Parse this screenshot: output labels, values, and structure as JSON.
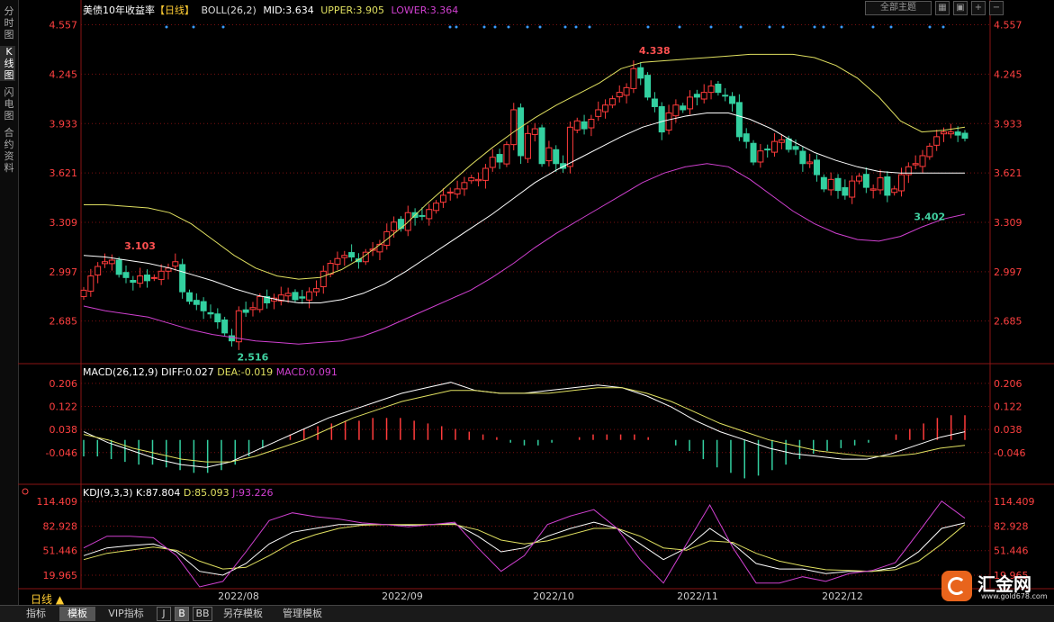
{
  "sidebar": {
    "tabs": [
      {
        "label": "分时图",
        "active": false
      },
      {
        "label": "K线图",
        "active": true
      },
      {
        "label": "闪电图",
        "active": false
      },
      {
        "label": "合约资料",
        "active": false
      }
    ]
  },
  "header": {
    "title": "美债10年收益率",
    "period_tag": "【日线】",
    "indicator": "BOLL(26,2)",
    "mid": "MID:3.634",
    "upper": "UPPER:3.905",
    "lower": "LOWER:3.364"
  },
  "toolbar": {
    "theme_select": "全部主题",
    "buttons": [
      "grid-icon",
      "lock-icon",
      "zoom-in-icon",
      "zoom-out-icon"
    ]
  },
  "macd_header": {
    "name": "MACD(26,12,9)",
    "diff": "DIFF:0.027",
    "dea": "DEA:-0.019",
    "macd": "MACD:0.091"
  },
  "kdj_header": {
    "name": "KDJ(9,3,3)",
    "k": "K:87.804",
    "d": "D:85.093",
    "j": "J:93.226"
  },
  "bottom_tabs": {
    "period": "日线 ▲",
    "tabs": [
      {
        "label": "指标",
        "active": false
      },
      {
        "label": "模板",
        "active": true
      },
      {
        "label": "VIP指标",
        "active": false
      },
      {
        "label": "J",
        "active": false
      },
      {
        "label": "B",
        "active": true
      },
      {
        "label": "BB",
        "active": false
      },
      {
        "label": "另存模板",
        "active": false
      },
      {
        "label": "管理模板",
        "active": false
      }
    ]
  },
  "logo": {
    "name": "汇金网",
    "url": "www.gold678.com"
  },
  "colors": {
    "up": "#ff3b3b",
    "down": "#33d0a0",
    "mid": "#ffffff",
    "upper": "#e0e060",
    "lower": "#d040d0",
    "grid": "#7a1010",
    "axis_text": "#ff4040",
    "macd_up": "#ff3b3b",
    "macd_down": "#33d0a0"
  },
  "chart_data": [
    {
      "type": "candlestick",
      "title": "美债10年收益率",
      "y_ticks": [
        4.557,
        4.245,
        3.933,
        3.621,
        3.309,
        2.997,
        2.685
      ],
      "ylim": [
        2.45,
        4.6
      ],
      "x_ticks": [
        "2022/08",
        "2022/09",
        "2022/10",
        "2022/11",
        "2022/12"
      ],
      "annotations": [
        {
          "label": "3.103",
          "value": 3.103,
          "kind": "high"
        },
        {
          "label": "2.516",
          "value": 2.516,
          "kind": "low"
        },
        {
          "label": "4.338",
          "value": 4.338,
          "kind": "high"
        },
        {
          "label": "3.402",
          "value": 3.402,
          "kind": "low"
        }
      ],
      "closes": [
        2.88,
        2.97,
        3.03,
        3.06,
        3.07,
        2.98,
        2.96,
        2.93,
        2.97,
        2.94,
        2.96,
        3.0,
        3.02,
        3.06,
        2.87,
        2.81,
        2.79,
        2.75,
        2.73,
        2.68,
        2.61,
        2.56,
        2.75,
        2.74,
        2.77,
        2.84,
        2.8,
        2.83,
        2.85,
        2.86,
        2.82,
        2.83,
        2.87,
        2.89,
        3.0,
        3.05,
        3.08,
        3.1,
        3.09,
        3.06,
        3.12,
        3.14,
        3.17,
        3.25,
        3.31,
        3.27,
        3.37,
        3.34,
        3.35,
        3.39,
        3.43,
        3.48,
        3.5,
        3.52,
        3.56,
        3.59,
        3.58,
        3.65,
        3.72,
        3.69,
        3.8,
        4.02,
        3.73,
        3.87,
        3.9,
        3.68,
        3.78,
        3.68,
        3.65,
        3.91,
        3.95,
        3.9,
        3.96,
        4.02,
        4.05,
        4.09,
        4.13,
        4.16,
        4.28,
        4.22,
        4.1,
        4.04,
        3.88,
        4.0,
        4.05,
        4.02,
        4.1,
        4.1,
        4.13,
        4.17,
        4.13,
        4.11,
        4.06,
        3.85,
        3.82,
        3.69,
        3.76,
        3.77,
        3.82,
        3.83,
        3.77,
        3.77,
        3.68,
        3.69,
        3.61,
        3.52,
        3.58,
        3.51,
        3.48,
        3.57,
        3.6,
        3.53,
        3.52,
        3.59,
        3.48,
        3.52,
        3.61,
        3.66,
        3.68,
        3.73,
        3.79,
        3.85,
        3.88,
        3.88,
        3.86,
        3.84
      ],
      "series": [
        {
          "name": "MID",
          "values": [
            3.1,
            3.09,
            3.07,
            3.05,
            3.02,
            2.98,
            2.94,
            2.89,
            2.85,
            2.82,
            2.8,
            2.8,
            2.82,
            2.86,
            2.92,
            3.0,
            3.09,
            3.18,
            3.27,
            3.36,
            3.46,
            3.56,
            3.64,
            3.71,
            3.78,
            3.85,
            3.91,
            3.95,
            3.98,
            4.0,
            4.0,
            3.96,
            3.9,
            3.82,
            3.75,
            3.7,
            3.66,
            3.63,
            3.62,
            3.62,
            3.62,
            3.62
          ]
        },
        {
          "name": "UPPER",
          "values": [
            3.42,
            3.42,
            3.41,
            3.4,
            3.37,
            3.3,
            3.2,
            3.1,
            3.02,
            2.97,
            2.95,
            2.96,
            3.01,
            3.09,
            3.19,
            3.3,
            3.43,
            3.55,
            3.67,
            3.78,
            3.88,
            3.97,
            4.05,
            4.12,
            4.19,
            4.28,
            4.32,
            4.33,
            4.34,
            4.35,
            4.36,
            4.37,
            4.37,
            4.37,
            4.35,
            4.3,
            4.22,
            4.1,
            3.95,
            3.88,
            3.89,
            3.91
          ]
        },
        {
          "name": "LOWER",
          "values": [
            2.78,
            2.75,
            2.73,
            2.71,
            2.67,
            2.63,
            2.6,
            2.58,
            2.56,
            2.55,
            2.54,
            2.55,
            2.56,
            2.59,
            2.64,
            2.7,
            2.76,
            2.82,
            2.88,
            2.96,
            3.05,
            3.15,
            3.24,
            3.32,
            3.4,
            3.48,
            3.56,
            3.62,
            3.66,
            3.68,
            3.66,
            3.58,
            3.48,
            3.38,
            3.3,
            3.24,
            3.2,
            3.19,
            3.22,
            3.28,
            3.33,
            3.36
          ]
        }
      ]
    },
    {
      "type": "bar",
      "title": "MACD(26,12,9)",
      "y_ticks": [
        0.206,
        0.122,
        0.038,
        -0.046
      ],
      "ylim": [
        -0.155,
        0.245
      ],
      "histogram": [
        -0.06,
        -0.06,
        -0.07,
        -0.08,
        -0.09,
        -0.09,
        -0.1,
        -0.11,
        -0.12,
        -0.12,
        -0.11,
        -0.09,
        -0.06,
        -0.03,
        0.0,
        0.02,
        0.04,
        0.05,
        0.06,
        0.07,
        0.07,
        0.08,
        0.08,
        0.08,
        0.07,
        0.06,
        0.05,
        0.04,
        0.03,
        0.02,
        0.01,
        -0.01,
        -0.02,
        -0.02,
        -0.01,
        0.0,
        0.01,
        0.02,
        0.02,
        0.02,
        0.02,
        0.01,
        0.0,
        -0.02,
        -0.04,
        -0.07,
        -0.1,
        -0.12,
        -0.14,
        -0.13,
        -0.11,
        -0.09,
        -0.07,
        -0.05,
        -0.04,
        -0.03,
        -0.02,
        -0.01,
        0.0,
        0.02,
        0.04,
        0.06,
        0.08,
        0.09,
        0.09
      ],
      "series": [
        {
          "name": "DIFF",
          "values": [
            0.03,
            -0.01,
            -0.04,
            -0.07,
            -0.09,
            -0.1,
            -0.08,
            -0.04,
            0.0,
            0.04,
            0.08,
            0.11,
            0.14,
            0.17,
            0.19,
            0.21,
            0.18,
            0.17,
            0.17,
            0.18,
            0.19,
            0.2,
            0.19,
            0.16,
            0.12,
            0.07,
            0.03,
            0.0,
            -0.03,
            -0.05,
            -0.06,
            -0.07,
            -0.07,
            -0.05,
            -0.02,
            0.01,
            0.03
          ]
        },
        {
          "name": "DEA",
          "values": [
            0.02,
            0.0,
            -0.03,
            -0.05,
            -0.07,
            -0.08,
            -0.08,
            -0.06,
            -0.03,
            0.0,
            0.04,
            0.08,
            0.11,
            0.14,
            0.16,
            0.18,
            0.18,
            0.17,
            0.17,
            0.17,
            0.18,
            0.19,
            0.19,
            0.17,
            0.14,
            0.1,
            0.06,
            0.03,
            0.0,
            -0.02,
            -0.04,
            -0.05,
            -0.06,
            -0.06,
            -0.05,
            -0.03,
            -0.02
          ]
        }
      ]
    },
    {
      "type": "line",
      "title": "KDJ(9,3,3)",
      "y_ticks": [
        114.409,
        82.928,
        51.446,
        19.965
      ],
      "ylim": [
        5,
        125
      ],
      "series": [
        {
          "name": "K",
          "values": [
            45,
            55,
            58,
            60,
            50,
            25,
            20,
            35,
            60,
            75,
            80,
            85,
            85,
            85,
            84,
            85,
            86,
            70,
            50,
            55,
            70,
            80,
            88,
            80,
            60,
            40,
            55,
            80,
            60,
            35,
            28,
            28,
            22,
            25,
            25,
            30,
            50,
            80,
            87
          ]
        },
        {
          "name": "D",
          "values": [
            40,
            48,
            52,
            56,
            52,
            38,
            28,
            30,
            45,
            62,
            72,
            80,
            84,
            85,
            85,
            85,
            85,
            78,
            65,
            60,
            64,
            72,
            80,
            80,
            70,
            55,
            52,
            64,
            62,
            48,
            38,
            32,
            27,
            26,
            25,
            27,
            38,
            60,
            85
          ]
        },
        {
          "name": "J",
          "values": [
            55,
            70,
            70,
            68,
            45,
            5,
            12,
            50,
            90,
            100,
            95,
            92,
            87,
            85,
            82,
            85,
            88,
            55,
            25,
            45,
            85,
            96,
            104,
            80,
            40,
            10,
            60,
            110,
            55,
            10,
            10,
            18,
            12,
            22,
            26,
            36,
            75,
            115,
            93
          ]
        }
      ]
    }
  ]
}
